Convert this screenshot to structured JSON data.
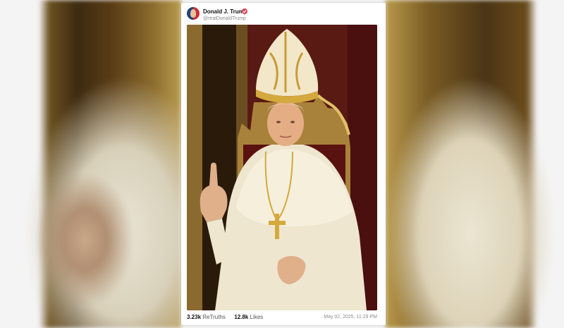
{
  "post": {
    "author_name": "Donald J. Trump",
    "author_handle": "@realDonaldTrump",
    "retruths_count": "3.23k",
    "retruths_label": "ReTruths",
    "likes_count": "12.8k",
    "likes_label": "Likes",
    "timestamp": "May 02, 2025, 11:29 PM"
  },
  "icons": {
    "verified": "verified-badge-icon",
    "avatar": "profile-avatar"
  },
  "colors": {
    "verified_badge": "#e0455a",
    "card_background": "#ffffff",
    "muted_text": "#8a8a8a"
  }
}
